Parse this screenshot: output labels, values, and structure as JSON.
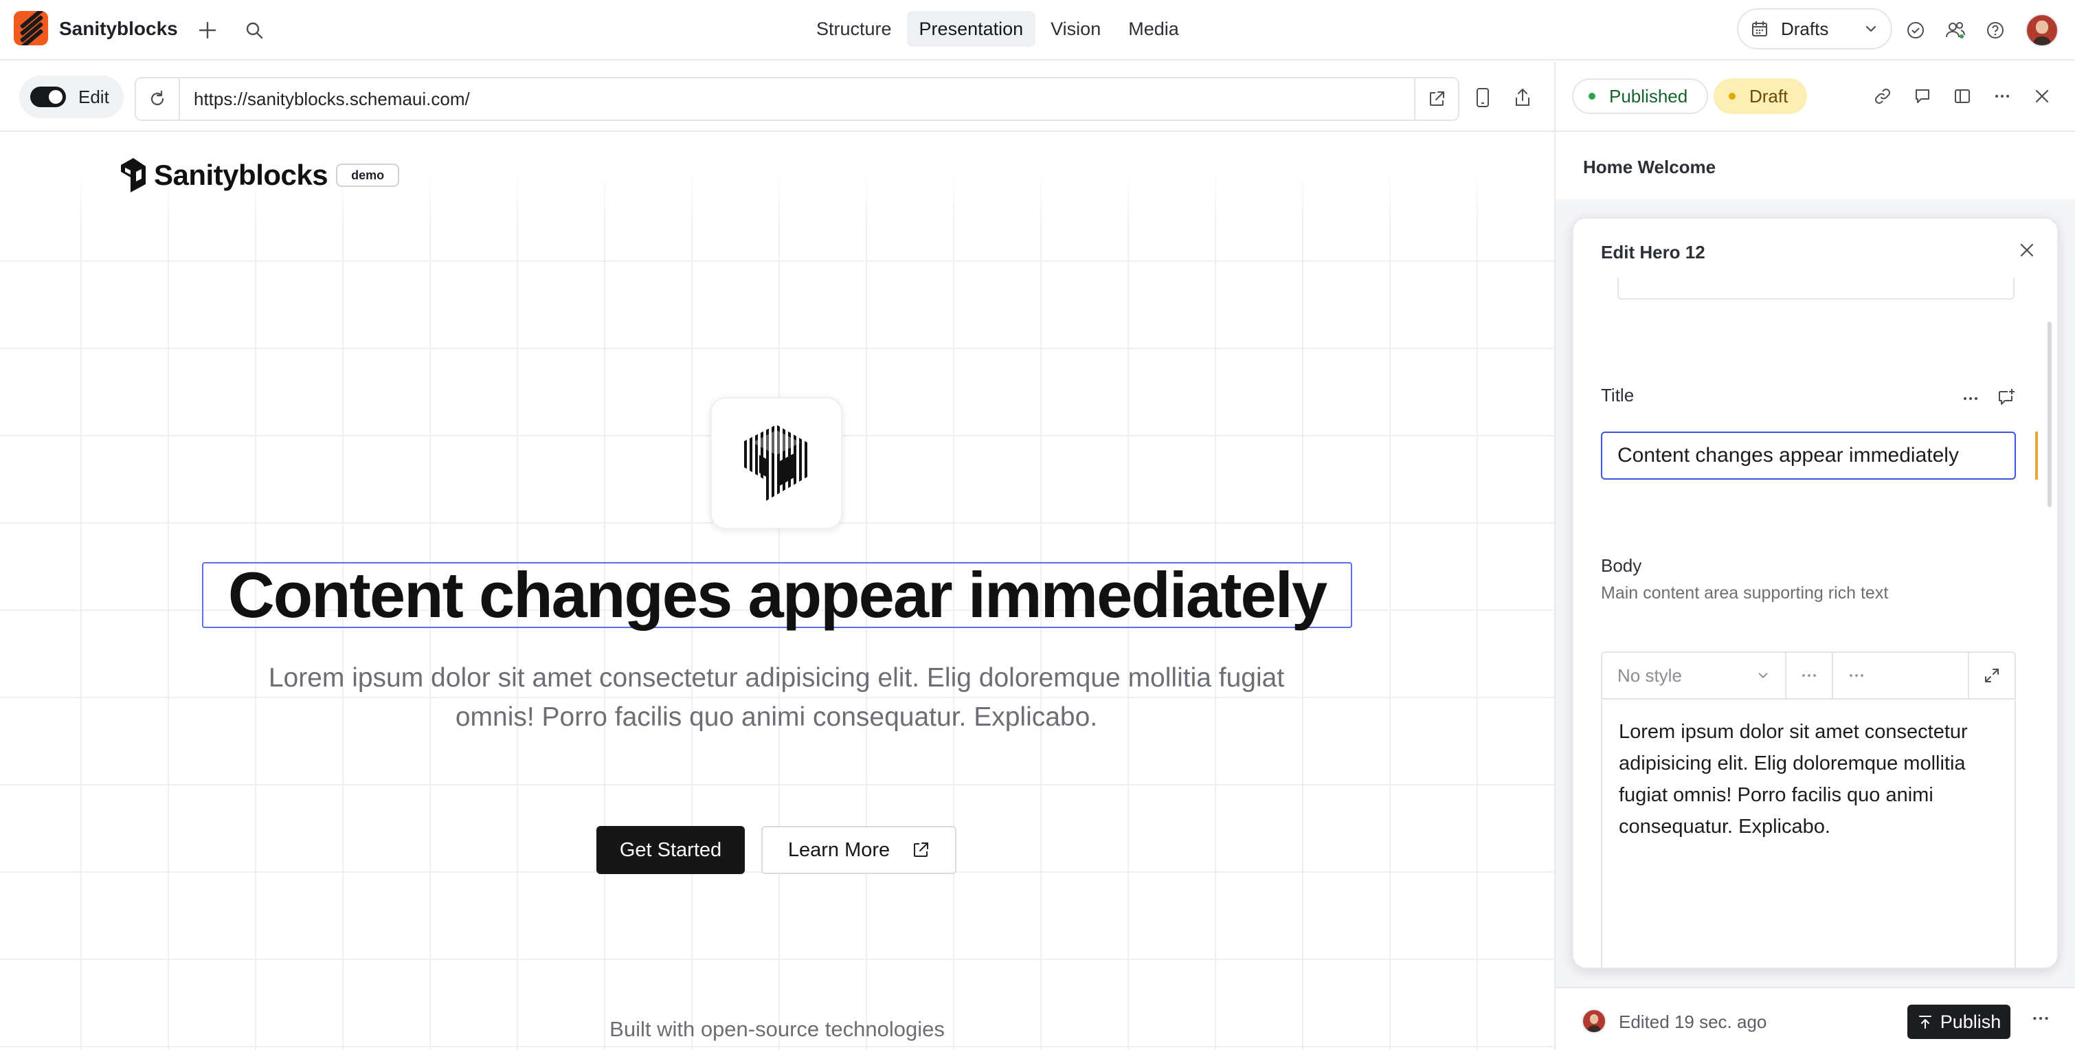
{
  "app": {
    "name": "Sanityblocks"
  },
  "nav": {
    "tabs": [
      {
        "label": "Structure",
        "active": false
      },
      {
        "label": "Presentation",
        "active": true
      },
      {
        "label": "Vision",
        "active": false
      },
      {
        "label": "Media",
        "active": false
      }
    ],
    "perspective": "Drafts"
  },
  "preview": {
    "edit_label": "Edit",
    "edit_toggle_on": true,
    "url": "https://sanityblocks.schemaui.com/"
  },
  "site": {
    "logo_name": "Sanityblocks",
    "badge": "demo",
    "hero_title": "Content changes appear immediately",
    "hero_body": "Lorem ipsum dolor sit amet consectetur adipisicing elit. Elig doloremque mollitia fugiat omnis! Porro facilis quo animi consequatur. Explicabo.",
    "primary_button": "Get Started",
    "secondary_button": "Learn More",
    "footer_teaser": "Built with open-source technologies"
  },
  "panel": {
    "status_published": "Published",
    "status_draft": "Draft",
    "document_title": "Home Welcome",
    "dialog_title": "Edit Hero 12",
    "fields": {
      "title_label": "Title",
      "title_value": "Content changes appear immediately",
      "body_label": "Body",
      "body_description": "Main content area supporting rich text",
      "body_style": "No style",
      "body_text": "Lorem ipsum dolor sit amet consectetur adipisicing elit. Elig doloremque mollitia fugiat omnis! Porro facilis quo animi consequatur. Explicabo."
    },
    "footer": {
      "edited": "Edited 19 sec. ago",
      "publish": "Publish"
    }
  },
  "colors": {
    "brand_orange": "#f05a1f",
    "selection_blue": "#3a55e0",
    "published_green": "#2da44e",
    "draft_yellow": "#e0a800",
    "changed_marker": "#e9a93a"
  },
  "icons": [
    "add-icon",
    "search-icon",
    "calendar-icon",
    "chevron-down-icon",
    "check-circle-icon",
    "users-icon",
    "help-icon",
    "refresh-icon",
    "external-link-icon",
    "mobile-icon",
    "share-icon",
    "link-icon",
    "comment-icon",
    "split-pane-icon",
    "more-icon",
    "close-icon",
    "add-comment-icon",
    "expand-icon",
    "publish-icon"
  ]
}
